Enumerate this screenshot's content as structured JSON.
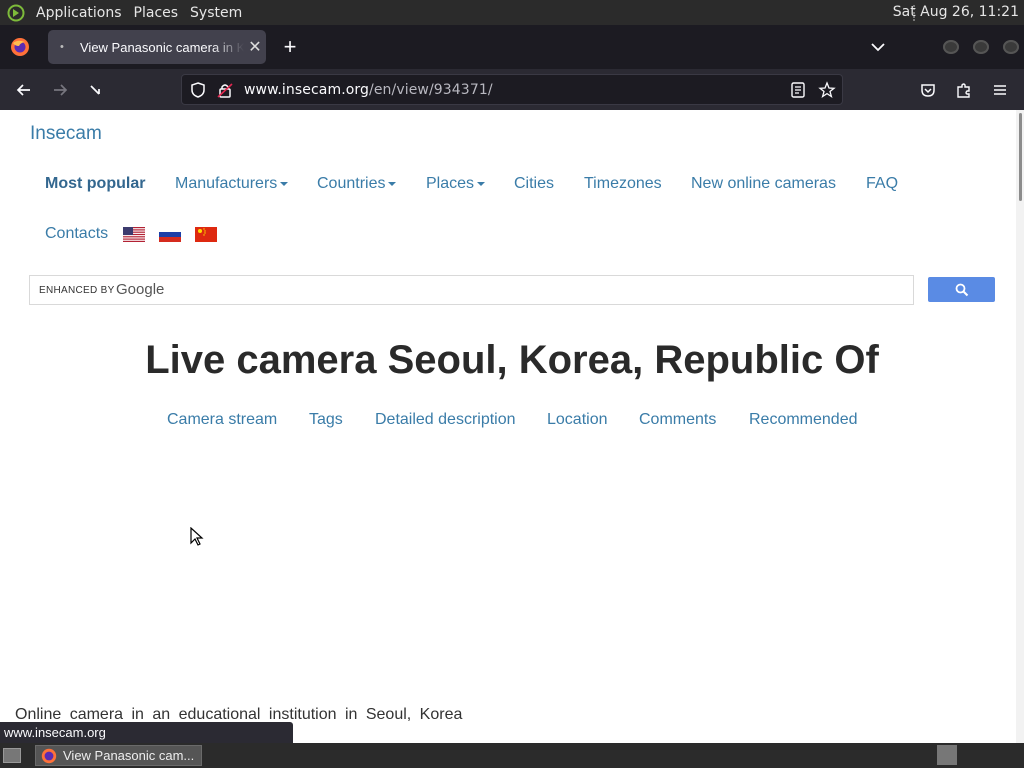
{
  "system": {
    "menus": [
      "Applications",
      "Places",
      "System"
    ],
    "clock": "Sat Aug 26, 11:21"
  },
  "browser": {
    "tab_title": "View Panasonic camera in Korea",
    "url_host": "www.insecam.org",
    "url_path": "/en/view/934371/",
    "status_url": "www.insecam.org"
  },
  "site": {
    "brand": "Insecam",
    "nav": {
      "most_popular": "Most popular",
      "manufacturers": "Manufacturers",
      "countries": "Countries",
      "places": "Places",
      "cities": "Cities",
      "timezones": "Timezones",
      "new_online": "New online cameras",
      "faq": "FAQ",
      "contacts": "Contacts"
    },
    "search": {
      "enhanced_by": "ENHANCED BY",
      "google": "Google"
    },
    "headline": "Live camera Seoul, Korea, Republic Of",
    "sections": {
      "camera_stream": "Camera stream",
      "tags": "Tags",
      "detailed_description": "Detailed description",
      "location": "Location",
      "comments": "Comments",
      "recommended": "Recommended"
    },
    "description": "Online camera in an educational institution in Seoul, Korea"
  },
  "taskbar": {
    "task_label": "View Panasonic cam..."
  }
}
